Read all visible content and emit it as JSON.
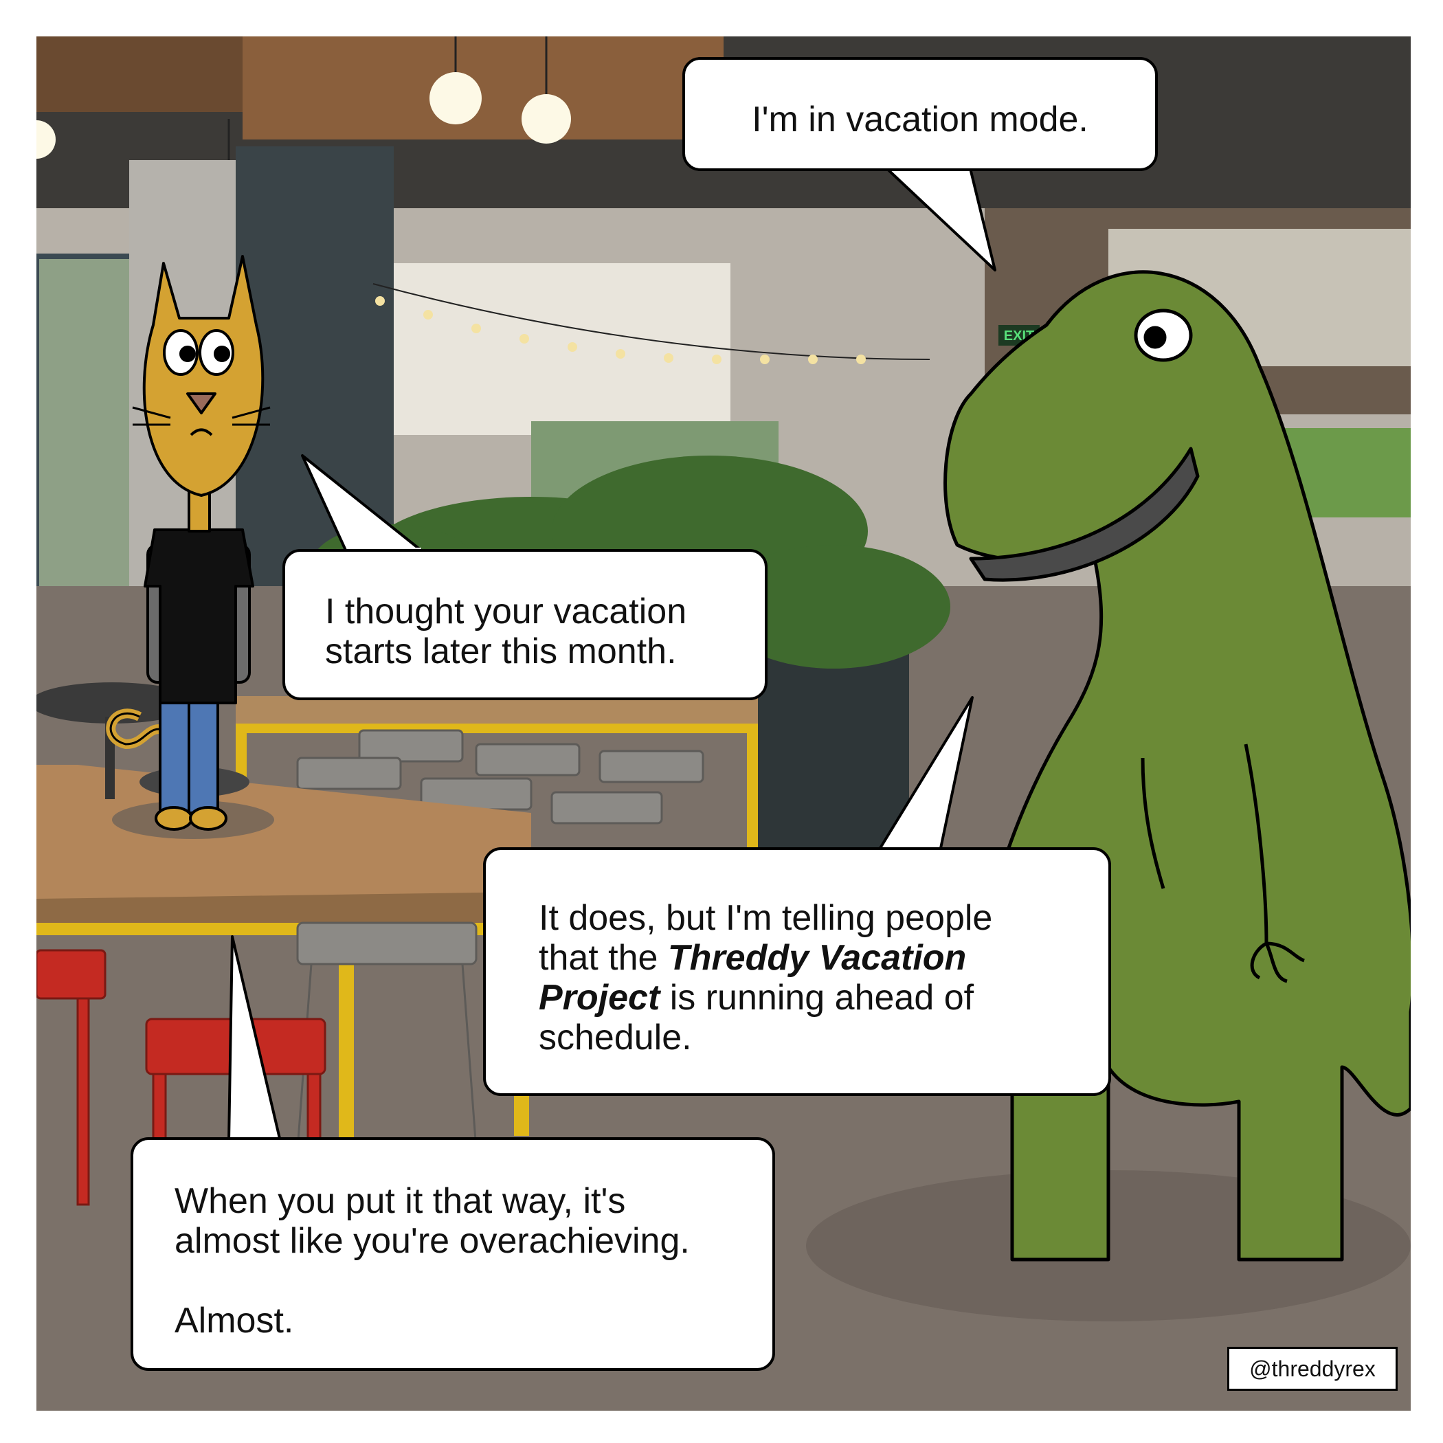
{
  "bubbles": {
    "vacation_mode": "I'm in vacation mode.",
    "thought_later": {
      "line1": "I thought your vacation",
      "line2": "starts later this month."
    },
    "ahead_schedule": {
      "line1": "It does, but I'm telling people",
      "line2_pre": "that the ",
      "line2_em": "Threddy Vacation",
      "line3_em": "Project",
      "line3_post": " is running ahead of",
      "line4": "schedule."
    },
    "overachieving": {
      "line1": "When you put it that way, it's",
      "line2": "almost like you're overachieving.",
      "line3": "Almost."
    }
  },
  "credit": "@threddyrex",
  "signage": {
    "exit_label": "EXIT"
  },
  "colors": {
    "dino_green": "#6b8a36",
    "cat_orange": "#d4a232",
    "table_yellow": "#e0b81a",
    "stool_red": "#c42a22",
    "floor": "#7b7169"
  }
}
